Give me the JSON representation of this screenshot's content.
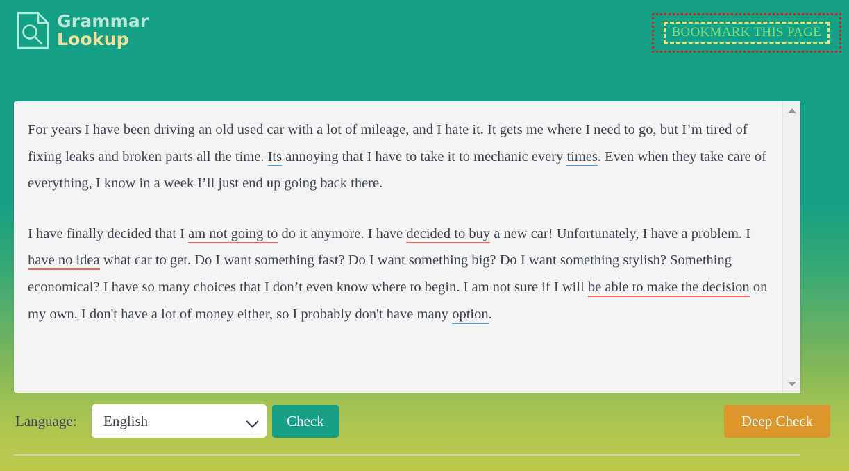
{
  "brand": {
    "logo_icon": "document-magnifier-icon",
    "name_line1": "Grammar",
    "name_line2": "Lookup",
    "color_line1": "#b9e8d6",
    "color_line2": "#f3e09a"
  },
  "header": {
    "bookmark_label": "BOOKMARK THIS PAGE",
    "bookmark_text_color": "#86dd7a",
    "bookmark_outer_border_color": "#d81f1f",
    "bookmark_inner_border_color": "#f2dc6d"
  },
  "theme": {
    "background_top": "#13a085",
    "background_bottom": "#bfc94e",
    "editor_background": "#f4f4f4",
    "text_color": "#3d4450",
    "spelling_underline": "#5a9bd5",
    "grammar_underline": "#f4645a",
    "check_button_color": "#17a086",
    "deep_check_button_color": "#dd962b"
  },
  "editor": {
    "scrollbar": {
      "up_arrow_icon": "triangle-up-icon",
      "down_arrow_icon": "triangle-down-icon"
    },
    "paragraphs": [
      {
        "id": "p1",
        "segments": [
          {
            "type": "text",
            "value": "For years I have been driving an old used car with a lot of mileage, and I hate it. It gets me where I need to go, but I’m tired of fixing leaks and broken parts all the time. "
          },
          {
            "type": "error-blue",
            "value": "Its"
          },
          {
            "type": "text",
            "value": " annoying that I have to take it to mechanic every "
          },
          {
            "type": "error-blue",
            "value": "times"
          },
          {
            "type": "text",
            "value": ". Even when they take care of everything, I know in a week I’ll just end up going back there."
          }
        ]
      },
      {
        "id": "p2",
        "segments": [
          {
            "type": "text",
            "value": "I have finally decided that I "
          },
          {
            "type": "error-red",
            "value": "am not going to"
          },
          {
            "type": "text",
            "value": " do it anymore. I have "
          },
          {
            "type": "error-red",
            "value": "decided to buy"
          },
          {
            "type": "text",
            "value": " a new car! Unfortunately, I have a problem. I "
          },
          {
            "type": "error-red",
            "value": "have no idea"
          },
          {
            "type": "text",
            "value": " what car to get. Do I want something fast? Do I want something big? Do I want something stylish? Something economical? I have so many choices that I don’t even know where to begin. I am not sure if I will "
          },
          {
            "type": "error-red",
            "value": "be able to make the decision"
          },
          {
            "type": "text",
            "value": " on my own. I don't have a lot of money either, so I probably don't have many "
          },
          {
            "type": "error-blue",
            "value": "option"
          },
          {
            "type": "text",
            "value": "."
          }
        ]
      }
    ]
  },
  "controls": {
    "language_label": "Language:",
    "language_selected": "English",
    "language_options": [
      "English"
    ],
    "chevron_icon": "chevron-down-icon",
    "check_label": "Check",
    "deep_check_label": "Deep Check"
  }
}
